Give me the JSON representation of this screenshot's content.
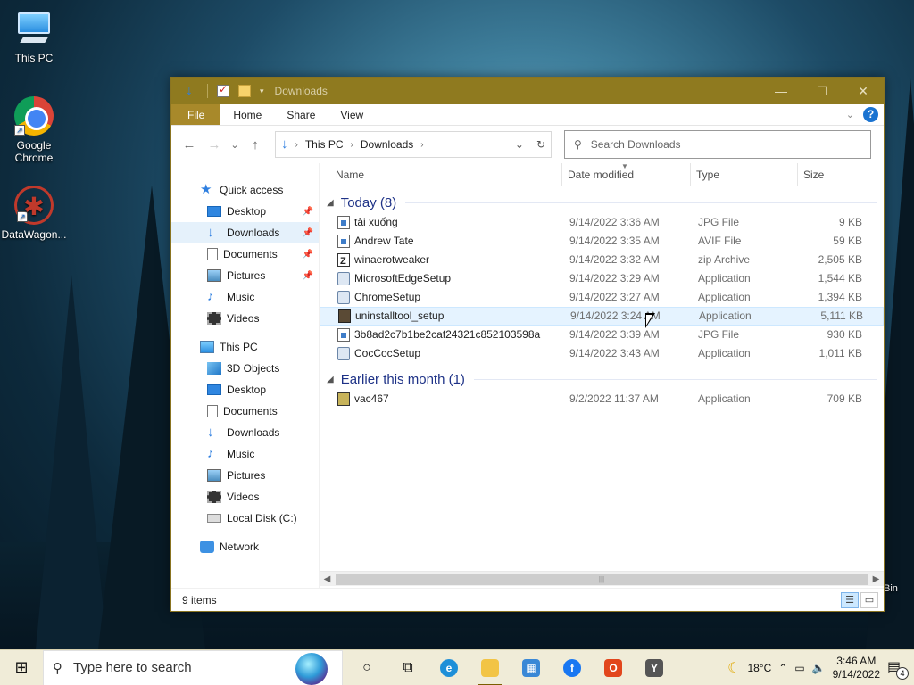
{
  "desktop": {
    "icons": [
      {
        "label": "This PC",
        "icon": "this-pc-icon"
      },
      {
        "label": "Google Chrome",
        "icon": "chrome-icon"
      },
      {
        "label": "DataWagon...",
        "icon": "datawagon-icon"
      }
    ],
    "bin_fragment": "Bin"
  },
  "window": {
    "title": "Downloads",
    "quick_access_toolbar": [
      "download-arrow-icon",
      "properties-icon",
      "new-folder-icon",
      "customize-chevron-icon"
    ],
    "controls": {
      "minimize": "—",
      "maximize": "☐",
      "close": "✕"
    },
    "ribbon_tabs": [
      "File",
      "Home",
      "Share",
      "View"
    ],
    "nav": {
      "back": "←",
      "forward": "→",
      "recent": "⌄",
      "up": "↑"
    },
    "address": {
      "segments": [
        "This PC",
        "Downloads"
      ],
      "refresh": "↻",
      "dropdown": "⌄"
    },
    "search": {
      "placeholder": "Search Downloads"
    },
    "sidebar": {
      "quick_access": "Quick access",
      "quick_items": [
        {
          "label": "Desktop",
          "pinned": true
        },
        {
          "label": "Downloads",
          "pinned": true,
          "selected": true
        },
        {
          "label": "Documents",
          "pinned": true
        },
        {
          "label": "Pictures",
          "pinned": true
        },
        {
          "label": "Music",
          "pinned": false
        },
        {
          "label": "Videos",
          "pinned": false
        }
      ],
      "this_pc": "This PC",
      "pc_items": [
        "3D Objects",
        "Desktop",
        "Documents",
        "Downloads",
        "Music",
        "Pictures",
        "Videos",
        "Local Disk (C:)"
      ],
      "network": "Network"
    },
    "columns": {
      "name": "Name",
      "date": "Date modified",
      "type": "Type",
      "size": "Size"
    },
    "groups": [
      {
        "label": "Today (8)",
        "files": [
          {
            "name": "tải xuống",
            "date": "9/14/2022 3:36 AM",
            "type": "JPG File",
            "size": "9 KB",
            "icon": "image-file-icon"
          },
          {
            "name": "Andrew Tate",
            "date": "9/14/2022 3:35 AM",
            "type": "AVIF File",
            "size": "59 KB",
            "icon": "image-file-icon"
          },
          {
            "name": "winaerotweaker",
            "date": "9/14/2022 3:32 AM",
            "type": "zip Archive",
            "size": "2,505 KB",
            "icon": "zip-file-icon"
          },
          {
            "name": "MicrosoftEdgeSetup",
            "date": "9/14/2022 3:29 AM",
            "type": "Application",
            "size": "1,544 KB",
            "icon": "setup-app-icon"
          },
          {
            "name": "ChromeSetup",
            "date": "9/14/2022 3:27 AM",
            "type": "Application",
            "size": "1,394 KB",
            "icon": "setup-app-icon"
          },
          {
            "name": "uninstalltool_setup",
            "date": "9/14/2022 3:24 AM",
            "type": "Application",
            "size": "5,111 KB",
            "icon": "installer-box-icon"
          },
          {
            "name": "3b8ad2c7b1be2caf24321c852103598a",
            "date": "9/14/2022 3:39 AM",
            "type": "JPG File",
            "size": "930 KB",
            "icon": "image-file-icon"
          },
          {
            "name": "CocCocSetup",
            "date": "9/14/2022 3:43 AM",
            "type": "Application",
            "size": "1,011 KB",
            "icon": "setup-app-icon"
          }
        ]
      },
      {
        "label": "Earlier this month (1)",
        "files": [
          {
            "name": "vac467",
            "date": "9/2/2022 11:37 AM",
            "type": "Application",
            "size": "709 KB",
            "icon": "vac-app-icon"
          }
        ]
      }
    ],
    "status": {
      "items": "9 items"
    }
  },
  "taskbar": {
    "search_placeholder": "Type here to search",
    "apps": [
      "task-view-icon",
      "edge-icon",
      "file-explorer-icon",
      "store-icon",
      "facebook-icon",
      "office-icon",
      "yandex-icon"
    ],
    "weather": {
      "temp": "18°C",
      "icon": "moon-icon"
    },
    "clock": {
      "time": "3:46 AM",
      "date": "9/14/2022"
    },
    "notifications": "4",
    "colors": {
      "accent": "#8f7a1f",
      "taskbar": "#f0ecd8"
    }
  }
}
